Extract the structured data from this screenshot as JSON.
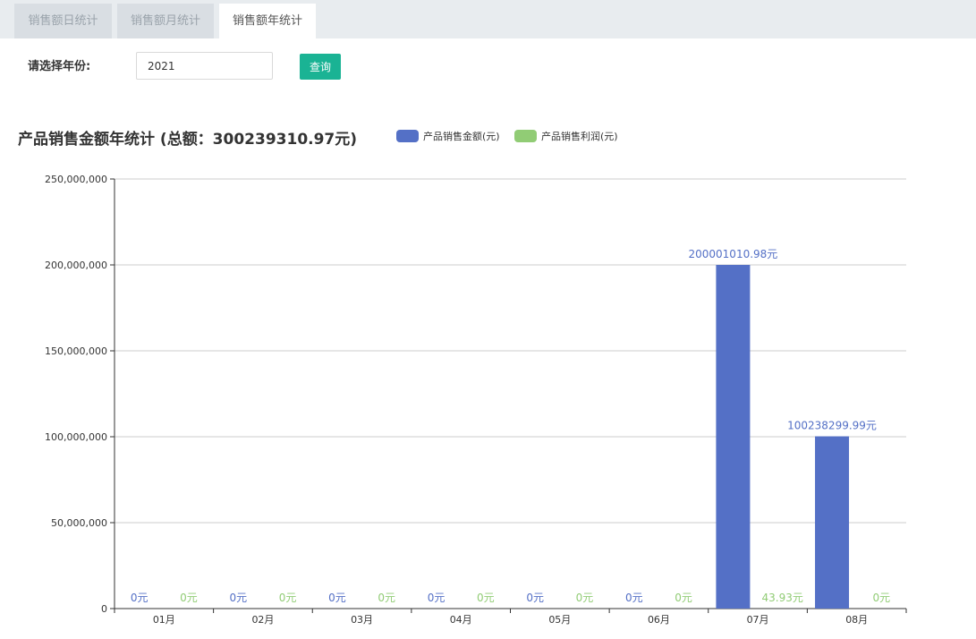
{
  "tabs": [
    {
      "label": "销售额日统计",
      "active": false
    },
    {
      "label": "销售额月统计",
      "active": false
    },
    {
      "label": "销售额年统计",
      "active": true
    }
  ],
  "form": {
    "label": "请选择年份:",
    "year_value": "2021",
    "query_label": "查询"
  },
  "colors": {
    "sales": "#5470c6",
    "profit": "#91cc75",
    "accent": "#1ab394"
  },
  "chart_data": {
    "type": "bar",
    "title": "产品销售金额年统计 (总额：300239310.97元)",
    "categories": [
      "01月",
      "02月",
      "03月",
      "04月",
      "05月",
      "06月",
      "07月",
      "08月"
    ],
    "ylim": [
      0,
      250000000
    ],
    "yticks": [
      0,
      50000000,
      100000000,
      150000000,
      200000000,
      250000000
    ],
    "ytick_labels": [
      "0",
      "50,000,000",
      "100,000,000",
      "150,000,000",
      "200,000,000",
      "250,000,000"
    ],
    "grid": true,
    "legend_position": "top",
    "series": [
      {
        "name": "产品销售金额(元)",
        "values": [
          0,
          0,
          0,
          0,
          0,
          0,
          200001010.98,
          100238299.99
        ],
        "labels": [
          "0元",
          "0元",
          "0元",
          "0元",
          "0元",
          "0元",
          "200001010.98元",
          "100238299.99元"
        ]
      },
      {
        "name": "产品销售利润(元)",
        "values": [
          0,
          0,
          0,
          0,
          0,
          0,
          43.93,
          0
        ],
        "labels": [
          "0元",
          "0元",
          "0元",
          "0元",
          "0元",
          "0元",
          "43.93元",
          "0元"
        ]
      }
    ]
  }
}
